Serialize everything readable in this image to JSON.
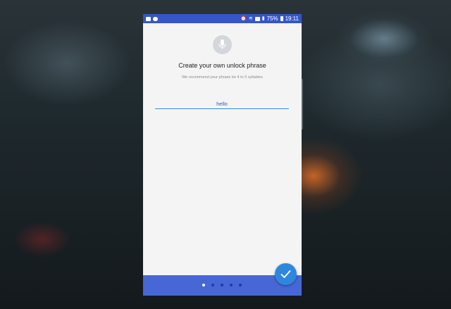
{
  "status_bar": {
    "battery": "75%",
    "time": "19:11",
    "left_icons": [
      "image-icon",
      "chat-bubble-icon"
    ],
    "right_icons": [
      "alarm-icon",
      "wifi-icon",
      "nfc-icon",
      "signal-icon",
      "battery-icon"
    ]
  },
  "header": {
    "icon": "mic-icon",
    "title": "Create your own unlock phrase",
    "subtitle": "We recommend your phrase be 4 to 5 syllables"
  },
  "input": {
    "value": "hello"
  },
  "pager": {
    "total": 5,
    "active_index": 0
  },
  "fab": {
    "icon": "checkmark-icon"
  },
  "colors": {
    "status_bar": "#3556c8",
    "bottom_bar": "#4767d6",
    "fab": "#2f86de",
    "input_underline": "#2e8fd6"
  }
}
